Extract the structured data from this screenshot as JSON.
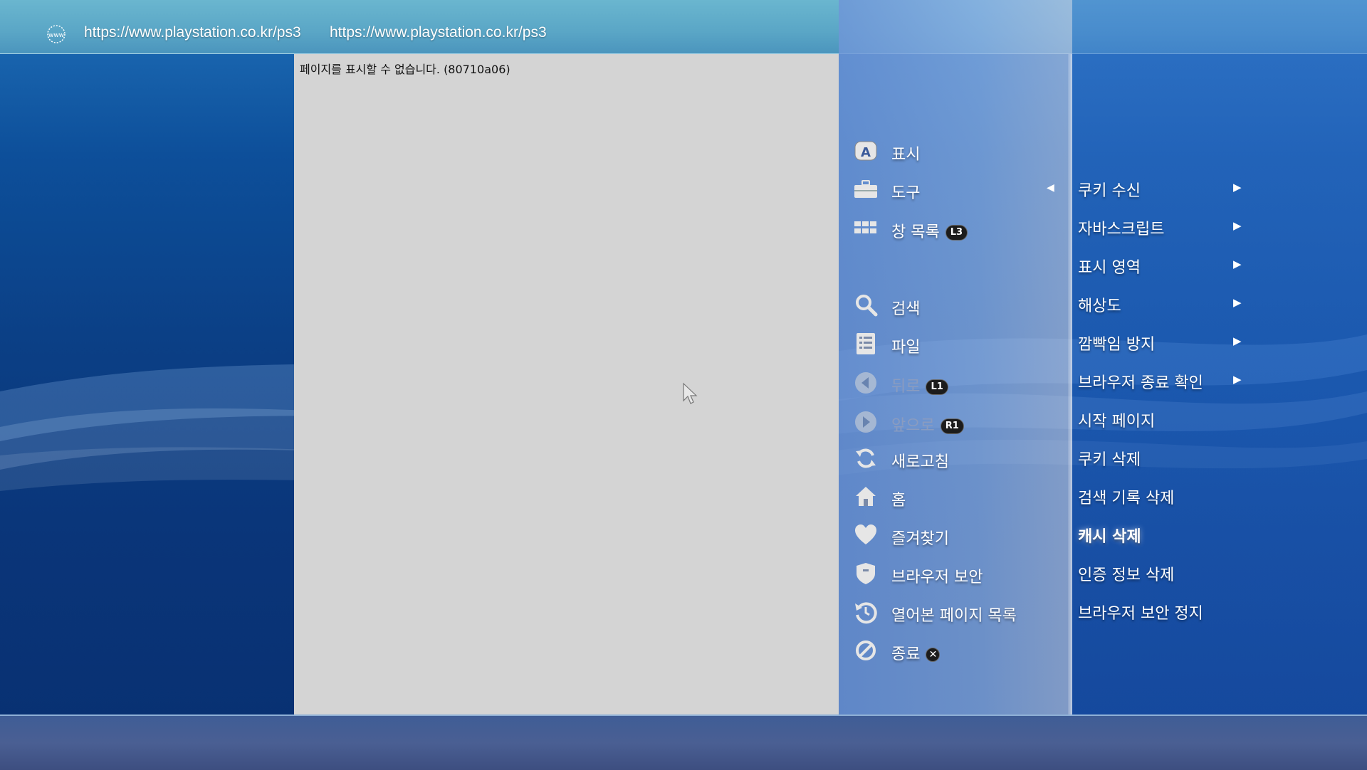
{
  "header": {
    "icon": "www-icon",
    "url_primary": "https://www.playstation.co.kr/ps3",
    "url_secondary": "https://www.playstation.co.kr/ps3"
  },
  "content": {
    "error_message": "페이지를 표시할 수 없습니다. (80710a06)"
  },
  "menu": {
    "items": [
      {
        "label": "표시",
        "icon": "a-display-icon"
      },
      {
        "label": "도구",
        "icon": "toolbox-icon"
      },
      {
        "label": "창 목록",
        "icon": "window-list-icon",
        "badge": "L3"
      },
      {
        "label": "검색",
        "icon": "search-icon"
      },
      {
        "label": "파일",
        "icon": "file-icon"
      },
      {
        "label": "뒤로",
        "icon": "back-icon",
        "badge": "L1",
        "disabled": true
      },
      {
        "label": "앞으로",
        "icon": "forward-icon",
        "badge": "R1",
        "disabled": true
      },
      {
        "label": "새로고침",
        "icon": "refresh-icon"
      },
      {
        "label": "홈",
        "icon": "home-icon"
      },
      {
        "label": "즐겨찾기",
        "icon": "heart-icon"
      },
      {
        "label": "브라우저 보안",
        "icon": "shield-icon"
      },
      {
        "label": "열어본 페이지 목록",
        "icon": "history-icon"
      },
      {
        "label": "종료",
        "icon": "exit-icon",
        "badge": "✕"
      }
    ]
  },
  "submenu": {
    "parent": "도구",
    "items": [
      {
        "label": "쿠키 수신",
        "has_submenu": true
      },
      {
        "label": "자바스크립트",
        "has_submenu": true
      },
      {
        "label": "표시 영역",
        "has_submenu": true
      },
      {
        "label": "해상도",
        "has_submenu": true
      },
      {
        "label": "깜빡임 방지",
        "has_submenu": true
      },
      {
        "label": "브라우저 종료 확인",
        "has_submenu": true
      },
      {
        "label": "시작 페이지",
        "has_submenu": false
      },
      {
        "label": "쿠키 삭제",
        "has_submenu": false
      },
      {
        "label": "검색 기록 삭제",
        "has_submenu": false
      },
      {
        "label": "캐시 삭제",
        "has_submenu": false,
        "selected": true
      },
      {
        "label": "인증 정보 삭제",
        "has_submenu": false
      },
      {
        "label": "브라우저 보안 정지",
        "has_submenu": false
      }
    ]
  },
  "colors": {
    "menu_text": "#ffffff",
    "disabled_text": "#8a9cc0",
    "content_bg": "#d4d4d4"
  }
}
